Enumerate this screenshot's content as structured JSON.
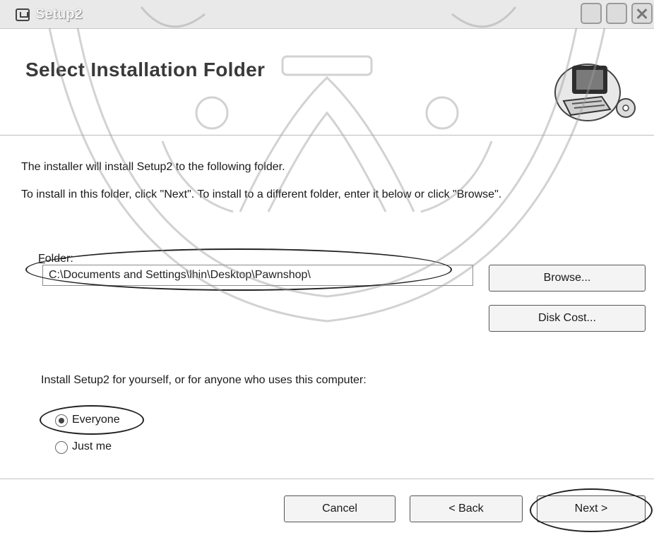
{
  "window": {
    "title": "Setup2"
  },
  "banner": {
    "heading": "Select Installation Folder"
  },
  "body": {
    "info": "The installer will install Setup2 to the following folder.",
    "instructions": "To install in this folder, click \"Next\". To install to a different folder, enter it below or click \"Browse\".",
    "folder_label_accel": "F",
    "folder_label_rest": "older:",
    "folder_path": "C:\\Documents and Settings\\lhin\\Desktop\\Pawnshop\\",
    "browse_label": "Browse...",
    "disk_cost_label": "Disk Cost...",
    "install_for": "Install Setup2 for yourself, or for anyone who uses this computer:",
    "radio_everyone": "Everyone",
    "radio_just_me": "Just me",
    "selected_option": "Everyone"
  },
  "footer": {
    "cancel_label": "Cancel",
    "back_label": "< Back",
    "next_label": "Next >"
  },
  "icons": [
    "setup-app-icon",
    "minimize-icon",
    "maximize-icon",
    "close-icon",
    "computer-install-icon",
    "radio-icon"
  ],
  "colors": {
    "title_bar": "#e9e9e9",
    "background": "#ffffff",
    "separator": "#c4c4c4"
  }
}
